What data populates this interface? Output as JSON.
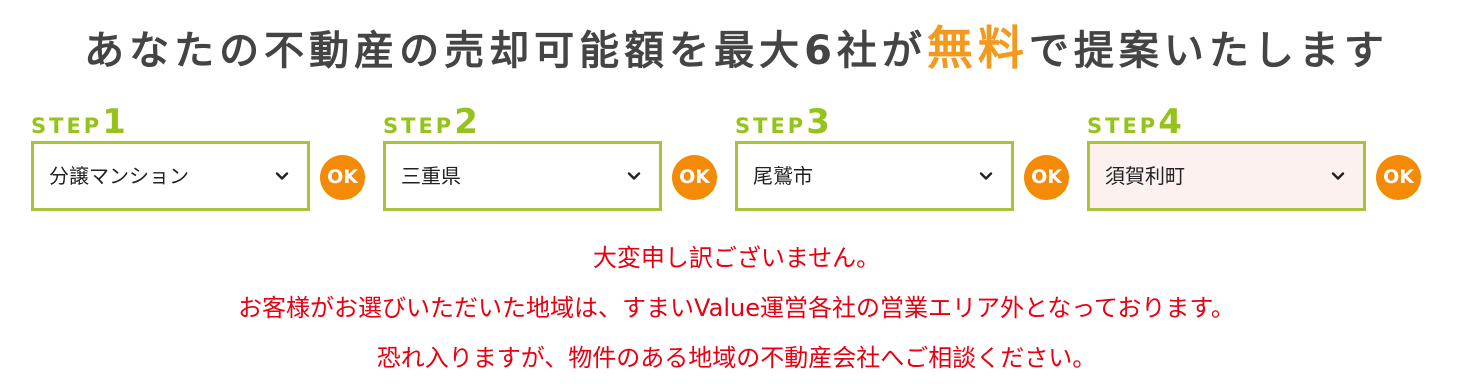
{
  "headline": {
    "before": "あなたの不動産の売却可能額を最大6社が",
    "accent": "無料",
    "after": "で提案いたします"
  },
  "steps": [
    {
      "word": "STEP",
      "num": "1",
      "value": "分譲マンション",
      "ok_label": "OK"
    },
    {
      "word": "STEP",
      "num": "2",
      "value": "三重県",
      "ok_label": "OK"
    },
    {
      "word": "STEP",
      "num": "3",
      "value": "尾鷲市",
      "ok_label": "OK"
    },
    {
      "word": "STEP",
      "num": "4",
      "value": "須賀利町",
      "ok_label": "OK"
    }
  ],
  "notice": {
    "line1": "大変申し訳ございません。",
    "line2": "お客様がお選びいただいた地域は、すまいValue運営各社の営業エリア外となっております。",
    "line3": "恐れ入りますが、物件のある地域の不動産会社へご相談ください。"
  },
  "colors": {
    "accent_orange": "#f39a1e",
    "step_green": "#97c21b",
    "ok_orange": "#f58a07",
    "error_red": "#e60012"
  }
}
